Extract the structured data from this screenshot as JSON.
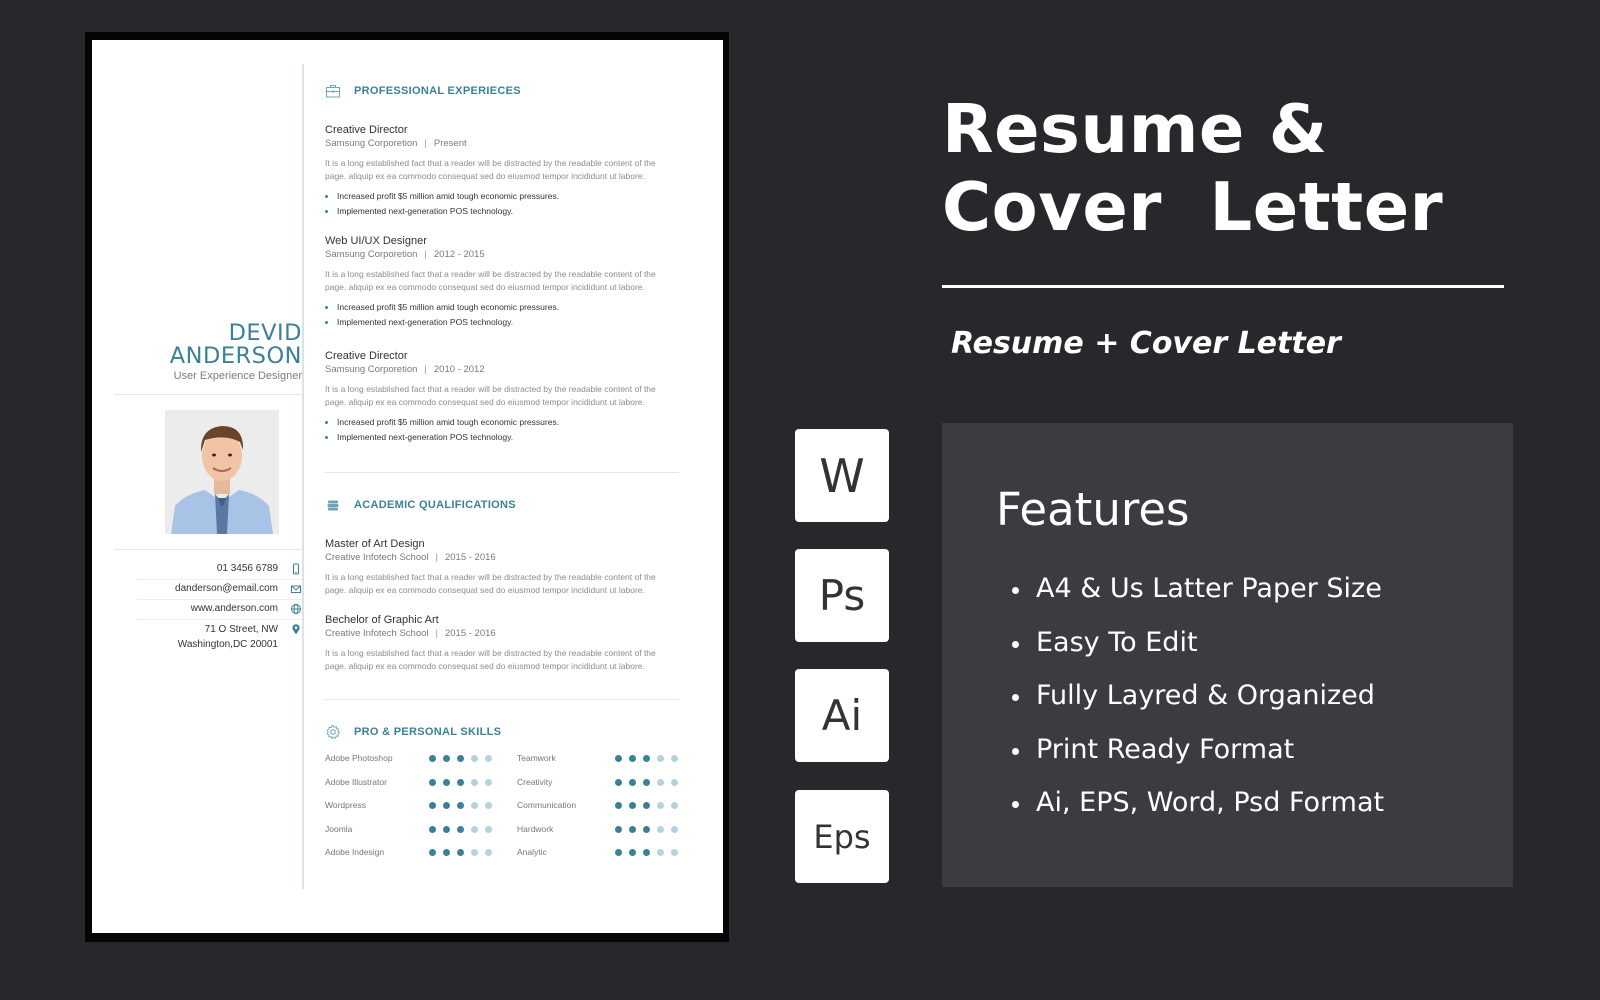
{
  "resume": {
    "name_first": "DEVID",
    "name_last": "ANDERSON",
    "role": "User Experience Designer",
    "accent_color": "#3a8196",
    "contacts": [
      {
        "icon": "phone-icon",
        "text": "01 3456 6789"
      },
      {
        "icon": "mail-icon",
        "text": "danderson@email.com"
      },
      {
        "icon": "globe-icon",
        "text": "www.anderson.com"
      },
      {
        "icon": "location-pin-icon",
        "text": "71 O Street, NW",
        "text2": "Washington,DC 20001"
      }
    ],
    "experience": {
      "heading": "PROFESSIONAL EXPERIECES",
      "icon": "briefcase-icon",
      "items": [
        {
          "title": "Creative Director",
          "company": "Samsung Corporetion",
          "separator": "|",
          "period": "Present",
          "desc": "It is a long established fact that a reader will be distracted by the readable content of the page. aliquip ex ea commodo consequat sed do eiusmod tempor incididunt ut labore.",
          "bullets": [
            "Increased profit $5 million amid tough economic pressures.",
            "Implemented next-generation POS technology."
          ]
        },
        {
          "title": "Web UI/UX Designer",
          "company": "Samsung Corporetion",
          "separator": "|",
          "period": "2012 - 2015",
          "desc": "It is a long established fact that a reader will be distracted by the readable content of the page. aliquip ex ea commodo consequat sed do eiusmod tempor incididunt ut labore.",
          "bullets": [
            "Increased profit $5 million amid tough economic pressures.",
            "Implemented next-generation POS technology."
          ]
        },
        {
          "title": "Creative Director",
          "company": "Samsung Corporetion",
          "separator": "|",
          "period": "2010 - 2012",
          "desc": "It is a long established fact that a reader will be distracted by the readable content of the page. aliquip ex ea commodo consequat sed do eiusmod tempor incididunt ut labore.",
          "bullets": [
            "Increased profit $5 million amid tough economic pressures.",
            "Implemented next-generation POS technology."
          ]
        }
      ]
    },
    "education": {
      "heading": "ACADEMIC QUALIFICATIONS",
      "icon": "books-icon",
      "items": [
        {
          "title": "Master of Art Design",
          "school": "Creative Infotech School",
          "separator": "|",
          "period": "2015 - 2016",
          "desc": "It is a long established fact that a reader will be distracted by the readable content of the page. aliquip ex ea commodo consequat sed do eiusmod tempor incididunt ut labore."
        },
        {
          "title": "Bechelor of Graphic Art",
          "school": "Creative Infotech School",
          "separator": "|",
          "period": "2015 - 2016",
          "desc": "It is a long established fact that a reader will be distracted by the readable content of the page. aliquip ex ea commodo consequat sed do eiusmod tempor incididunt ut labore."
        }
      ]
    },
    "skills": {
      "heading": "PRO & PERSONAL SKILLS",
      "icon": "gear-icon",
      "max": 5,
      "pro": [
        {
          "name": "Adobe Photoshop",
          "level": 3
        },
        {
          "name": "Adobe Illustrator",
          "level": 3
        },
        {
          "name": "Wordpress",
          "level": 3
        },
        {
          "name": "Joomla",
          "level": 3
        },
        {
          "name": "Adobe Indesign",
          "level": 3
        }
      ],
      "personal": [
        {
          "name": "Teamwork",
          "level": 3
        },
        {
          "name": "Creativity",
          "level": 3
        },
        {
          "name": "Communication",
          "level": 3
        },
        {
          "name": "Hardwork",
          "level": 3
        },
        {
          "name": "Analytic",
          "level": 3
        }
      ]
    }
  },
  "promo": {
    "title_line1": "Resume &",
    "title_line2": "Cover  Letter",
    "subtitle": "Resume + Cover Letter",
    "formats": [
      {
        "label": "W",
        "icon": "word-format-icon"
      },
      {
        "label": "Ps",
        "icon": "photoshop-format-icon"
      },
      {
        "label": "Ai",
        "icon": "illustrator-format-icon"
      },
      {
        "label": "Eps",
        "icon": "eps-format-icon"
      }
    ],
    "features_heading": "Features",
    "features": [
      "A4 & Us Latter Paper Size",
      "Easy To Edit",
      "Fully Layred & Organized",
      "Print Ready Format",
      "Ai, EPS, Word, Psd Format"
    ]
  }
}
